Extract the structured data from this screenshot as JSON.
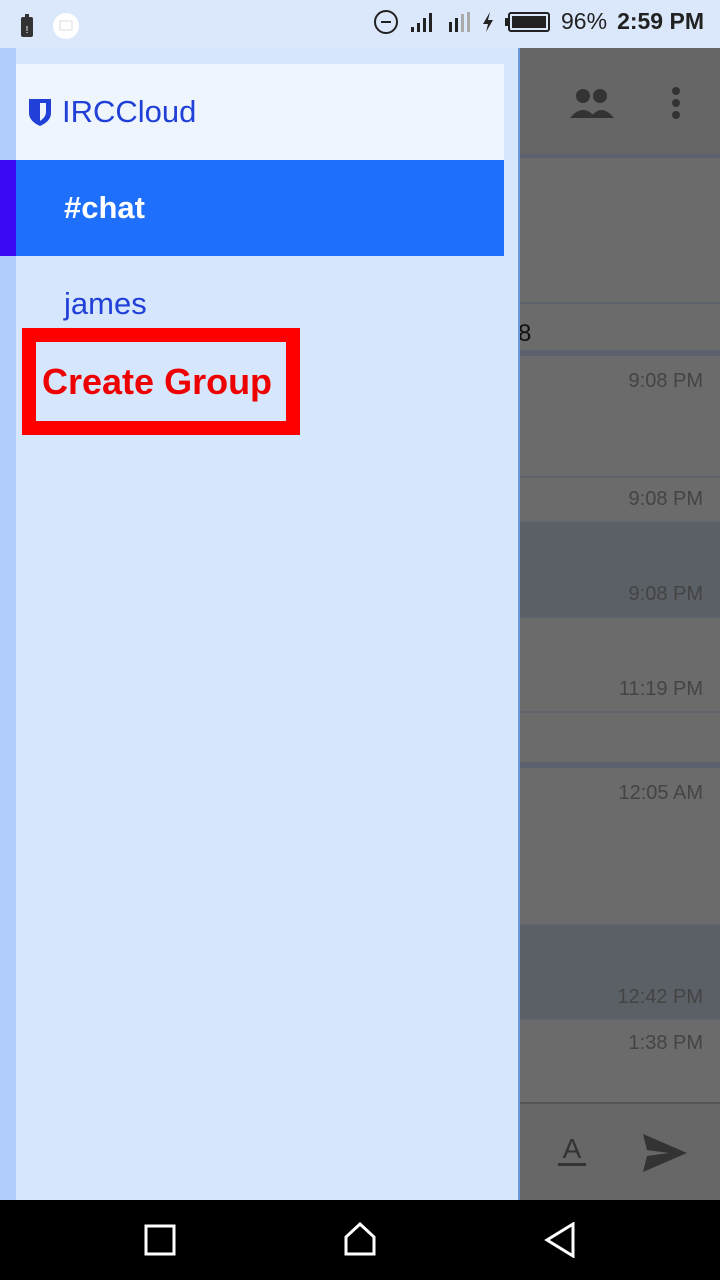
{
  "status_bar": {
    "battery_percent": "96%",
    "time": "2:59 PM",
    "icons": [
      "battery-alert-icon",
      "mail-icon",
      "do-not-disturb-icon",
      "signal-icon",
      "data-signal-icon",
      "charging-icon",
      "battery-icon"
    ]
  },
  "drawer": {
    "app_name": "IRCCloud",
    "items": [
      {
        "label": "#chat",
        "selected": true
      },
      {
        "label": "james"
      }
    ],
    "create_group": "Create Group"
  },
  "chat": {
    "partial_text": "8",
    "timestamps": [
      "9:08 PM",
      "9:08 PM",
      "9:08 PM",
      "11:19 PM",
      "12:05 AM",
      "12:42 PM",
      "1:38 PM"
    ]
  },
  "colors": {
    "accent": "#1e6ffc",
    "link": "#2040d8",
    "highlight": "#ff0000"
  }
}
